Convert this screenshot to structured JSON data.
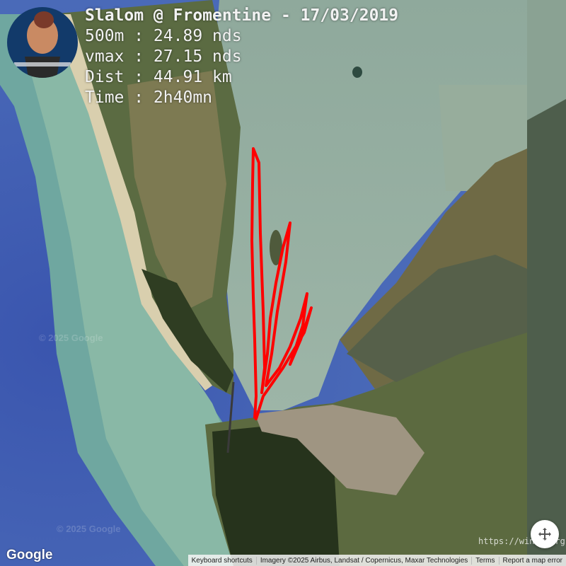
{
  "overlay": {
    "title": "Slalom @ Fromentine - 17/03/2019",
    "stats": [
      "500m : 24.89 nds",
      "vmax : 27.15 nds",
      "Dist : 44.91 km",
      "Time : 2h40mn"
    ]
  },
  "map": {
    "watermarks": [
      "© 2025 Google",
      "© 2025 Google"
    ],
    "track_color": "#ff0000",
    "logo": "Google",
    "watermark_site": "https://windr.org"
  },
  "attribution": {
    "shortcuts": "Keyboard shortcuts",
    "imagery": "Imagery ©2025 Airbus, Landsat / Copernicus, Maxar Technologies",
    "terms": "Terms",
    "report": "Report a map error"
  },
  "controls": {
    "fullscreen_icon": "fullscreen-icon"
  }
}
